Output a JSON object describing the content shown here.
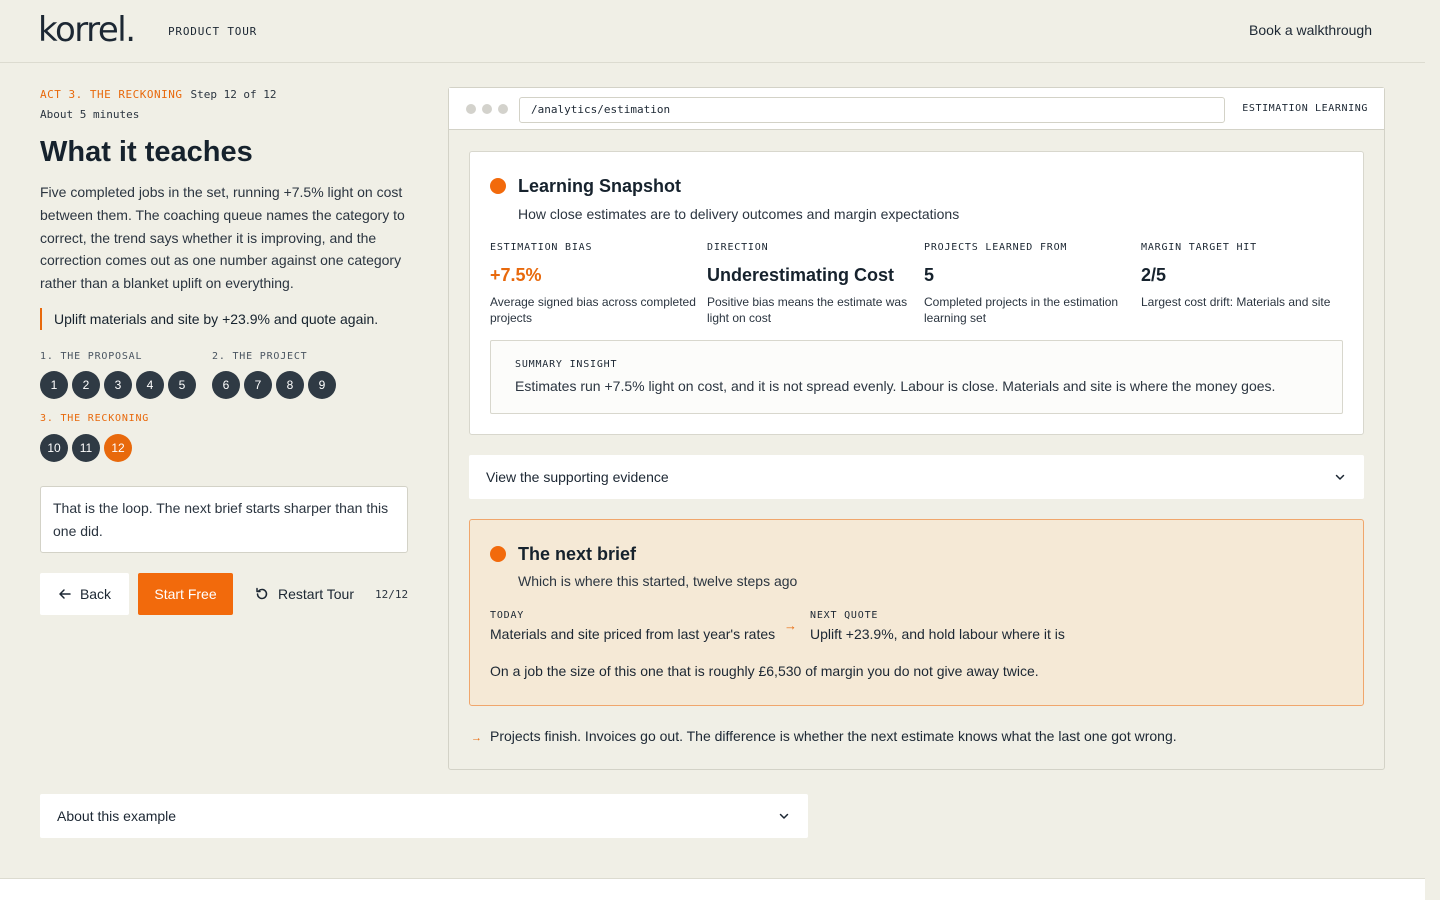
{
  "header": {
    "logo": "korrel.",
    "section": "PRODUCT TOUR",
    "cta": "Book a walkthrough"
  },
  "tour": {
    "act": "ACT 3. THE RECKONING",
    "step": "Step 12 of 12",
    "duration": "About 5 minutes",
    "title": "What it teaches",
    "body": "Five completed jobs in the set, running +7.5% light on cost between them. The coaching queue names the category to correct, the trend says whether it is improving, and the correction comes out as one number against one category rather than a blanket uplift on everything.",
    "callout": "Uplift materials and site by +23.9% and quote again.",
    "sections": [
      {
        "label": "1. THE PROPOSAL",
        "steps": [
          "1",
          "2",
          "3",
          "4",
          "5"
        ]
      },
      {
        "label": "2. THE PROJECT",
        "steps": [
          "6",
          "7",
          "8",
          "9"
        ]
      },
      {
        "label": "3. THE RECKONING",
        "steps": [
          "10",
          "11",
          "12"
        ]
      }
    ],
    "current_step": "12",
    "loop_text": "That is the loop. The next brief starts sharper than this one did.",
    "back_label": "Back",
    "start_label": "Start Free",
    "restart_label": "Restart Tour",
    "counter": "12/12",
    "about_label": "About this example"
  },
  "browser": {
    "url": "/analytics/estimation",
    "label": "ESTIMATION LEARNING"
  },
  "snapshot": {
    "title": "Learning Snapshot",
    "subtitle": "How close estimates are to delivery outcomes and margin expectations",
    "metrics": [
      {
        "label": "ESTIMATION BIAS",
        "value": "+7.5%",
        "desc": "Average signed bias across completed projects"
      },
      {
        "label": "DIRECTION",
        "value": "Underestimating Cost",
        "desc": "Positive bias means the estimate was light on cost"
      },
      {
        "label": "PROJECTS LEARNED FROM",
        "value": "5",
        "desc": "Completed projects in the estimation learning set"
      },
      {
        "label": "MARGIN TARGET HIT",
        "value": "2/5",
        "desc": "Largest cost drift: Materials and site"
      }
    ],
    "insight_label": "SUMMARY INSIGHT",
    "insight_text": "Estimates run +7.5% light on cost, and it is not spread evenly. Labour is close. Materials and site is where the money goes."
  },
  "evidence_label": "View the supporting evidence",
  "next_brief": {
    "title": "The next brief",
    "subtitle": "Which is where this started, twelve steps ago",
    "today_label": "TODAY",
    "today_text": "Materials and site priced from last year's rates",
    "next_label": "NEXT QUOTE",
    "next_text": "Uplift +23.9%, and hold labour where it is",
    "note": "On a job the size of this one that is roughly £6,530 of margin you do not give away twice."
  },
  "closing": "Projects finish. Invoices go out. The difference is whether the next estimate knows what the last one got wrong.",
  "colors": {
    "accent": "#f26a0c",
    "background": "#f0efe6",
    "dark": "#2f3a44",
    "brief_bg": "#f5e9d6"
  },
  "icons": {
    "back": "arrow-left-icon",
    "restart": "restart-icon",
    "expand": "chevron-down-icon",
    "transition": "arrow-right-icon"
  }
}
